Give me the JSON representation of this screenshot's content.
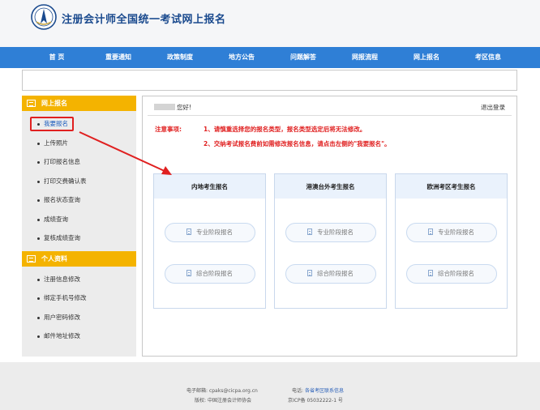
{
  "header": {
    "site_title": "注册会计师全国统一考试网上报名",
    "logo_icon": "cicpa-logo-icon"
  },
  "nav": {
    "items": [
      "首 页",
      "重要通知",
      "政策制度",
      "地方公告",
      "问题解答",
      "网报流程",
      "网上报名",
      "考区信息"
    ]
  },
  "sidebar": {
    "section1_title": "网上报名",
    "section1_items": [
      "我要报名",
      "上传照片",
      "打印报名信息",
      "打印交费确认表",
      "报名状态查询",
      "成绩查询",
      "复核成绩查询"
    ],
    "section2_title": "个人资料",
    "section2_items": [
      "注册信息修改",
      "绑定手机号修改",
      "用户密码修改",
      "邮件地址修改"
    ]
  },
  "main": {
    "greeting": "您好!",
    "logout": "退出登录",
    "notice_label": "注意事项:",
    "notice_lines": [
      "1、请慎重选择您的报名类型，报名类型选定后将无法修改。",
      "2、交纳考试报名费前如需修改报名信息，请点击左侧的\"我要报名\"。"
    ],
    "cards": [
      {
        "title": "内地考生报名",
        "btn1": "专业阶段报名",
        "btn2": "综合阶段报名"
      },
      {
        "title": "港澳台外考生报名",
        "btn1": "专业阶段报名",
        "btn2": "综合阶段报名"
      },
      {
        "title": "欧洲考区考生报名",
        "btn1": "专业阶段报名",
        "btn2": "综合阶段报名"
      }
    ]
  },
  "footer": {
    "email_label": "电子邮箱:",
    "email": "cpaks@cicpa.org.cn",
    "phone_label": "电话:",
    "phone_link": "各省考区联系信息",
    "copyright_label": "版权:",
    "copyright": "中国注册会计师协会",
    "icp": "京ICP备 05032222-1 号"
  },
  "colors": {
    "nav_blue": "#2f7fd6",
    "sidebar_orange": "#f4b300",
    "notice_red": "#e02020",
    "card_head": "#eaf2fc"
  }
}
